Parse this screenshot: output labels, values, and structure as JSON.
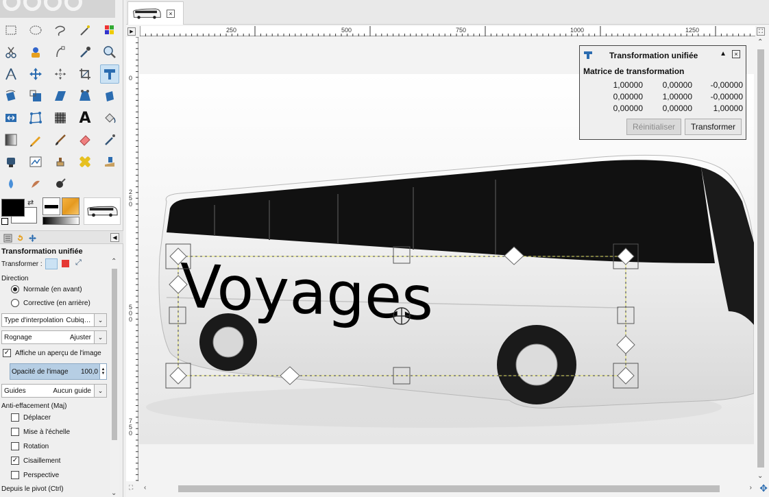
{
  "toolbox": {
    "tools": [
      {
        "name": "rect-select-icon"
      },
      {
        "name": "ellipse-select-icon"
      },
      {
        "name": "free-select-icon"
      },
      {
        "name": "fuzzy-select-icon"
      },
      {
        "name": "color-select-icon"
      },
      {
        "name": "scissors-select-icon"
      },
      {
        "name": "foreground-select-icon"
      },
      {
        "name": "paths-icon"
      },
      {
        "name": "color-picker-icon"
      },
      {
        "name": "zoom-icon"
      },
      {
        "name": "measure-icon"
      },
      {
        "name": "move-icon"
      },
      {
        "name": "align-icon"
      },
      {
        "name": "crop-icon"
      },
      {
        "name": "unified-transform-icon",
        "active": true
      },
      {
        "name": "rotate-icon"
      },
      {
        "name": "scale-icon"
      },
      {
        "name": "shear-icon"
      },
      {
        "name": "perspective-icon"
      },
      {
        "name": "3d-transform-icon"
      },
      {
        "name": "flip-icon"
      },
      {
        "name": "cage-transform-icon"
      },
      {
        "name": "warp-transform-icon"
      },
      {
        "name": "text-icon"
      },
      {
        "name": "bucket-fill-icon"
      },
      {
        "name": "gradient-icon"
      },
      {
        "name": "pencil-icon"
      },
      {
        "name": "paintbrush-icon"
      },
      {
        "name": "eraser-icon"
      },
      {
        "name": "airbrush-icon"
      },
      {
        "name": "ink-icon"
      },
      {
        "name": "mypaint-brush-icon"
      },
      {
        "name": "clone-icon"
      },
      {
        "name": "heal-icon"
      },
      {
        "name": "perspective-clone-icon"
      },
      {
        "name": "blur-icon"
      },
      {
        "name": "smudge-icon"
      },
      {
        "name": "dodge-burn-icon"
      }
    ],
    "text_tool_glyph": "A",
    "fg_color": "#000000",
    "bg_color": "#ffffff"
  },
  "tool_options": {
    "title": "Transformation unifiée",
    "transform_label": "Transformer :",
    "direction_label": "Direction",
    "direction_options": [
      {
        "label": "Normale (en avant)",
        "selected": true
      },
      {
        "label": "Corrective (en arrière)",
        "selected": false
      }
    ],
    "interpolation": {
      "label": "Type d'interpolation",
      "value": "Cubiq…"
    },
    "clipping": {
      "label": "Rognage",
      "value": "Ajuster"
    },
    "preview": {
      "label": "Affiche un aperçu de l'image",
      "checked": true
    },
    "opacity": {
      "label": "Opacité de l'image",
      "value": "100,0"
    },
    "guides": {
      "label": "Guides",
      "value": "Aucun guide"
    },
    "anti_erase_label": "Anti-effacement (Maj)",
    "constraints": [
      {
        "label": "Déplacer",
        "checked": false
      },
      {
        "label": "Mise à l'échelle",
        "checked": false
      },
      {
        "label": "Rotation",
        "checked": false
      },
      {
        "label": "Cisaillement",
        "checked": true
      },
      {
        "label": "Perspective",
        "checked": false
      }
    ],
    "pivot_label": "Depuis le pivot  (Ctrl)"
  },
  "image_window": {
    "ruler_h_labels": [
      "250",
      "500",
      "750",
      "1000",
      "1250"
    ],
    "ruler_v_labels": [
      "0",
      "2\n5\n0",
      "5\n0\n0",
      "7\n5\n0"
    ],
    "canvas_text": "Voyages",
    "tab_close": "×"
  },
  "dialog": {
    "title": "Transformation unifiée",
    "matrix_title": "Matrice de transformation",
    "matrix": [
      [
        "1,00000",
        "0,00000",
        "-0,00000"
      ],
      [
        "0,00000",
        "1,00000",
        "-0,00000"
      ],
      [
        "0,00000",
        "0,00000",
        "1,00000"
      ]
    ],
    "reset_label": "Réinitialiser",
    "apply_label": "Transformer",
    "close_glyph": "×",
    "collapse_glyph": "▲"
  }
}
